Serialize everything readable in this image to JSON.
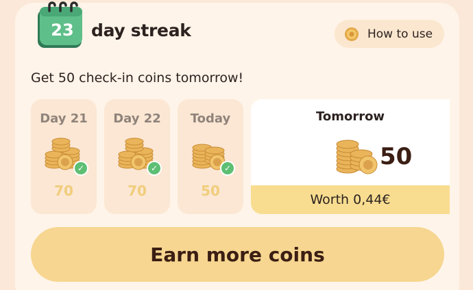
{
  "streak": {
    "count": "23",
    "title": "day streak"
  },
  "how_to_use": {
    "label": "How to use"
  },
  "subtitle": "Get 50 check-in coins tomorrow!",
  "days": [
    {
      "label": "Day 21",
      "amount": "70",
      "checked": true
    },
    {
      "label": "Day 22",
      "amount": "70",
      "checked": true
    },
    {
      "label": "Today",
      "amount": "50",
      "checked": true
    }
  ],
  "tomorrow": {
    "label": "Tomorrow",
    "amount": "50",
    "worth": "Worth 0,44€"
  },
  "earn_button": {
    "label": "Earn more coins"
  },
  "colors": {
    "card_bg": "#fff4e9",
    "day_card_bg": "#fbe7d3",
    "accent_yellow": "#f6d690",
    "check_green": "#5dbf73",
    "dark_text": "#2c2220"
  },
  "icons": [
    "calendar-icon",
    "coin-icon",
    "coin-stack-icon",
    "checkmark-icon"
  ]
}
